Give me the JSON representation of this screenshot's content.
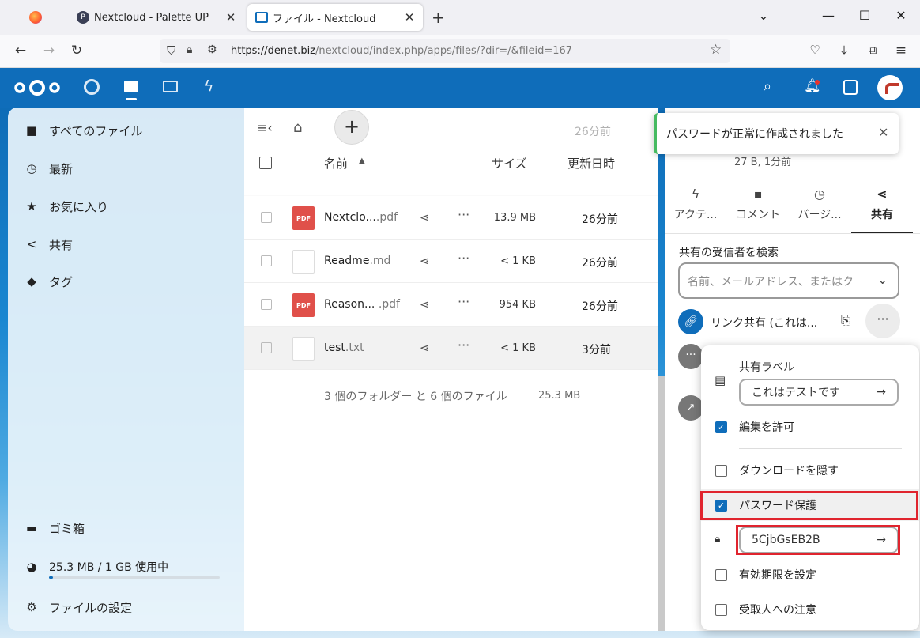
{
  "browser": {
    "tabs": [
      {
        "title": ""
      },
      {
        "title": "Nextcloud - Palette UP"
      },
      {
        "title": "ファイル - Nextcloud"
      }
    ],
    "url_host": "https://denet.biz",
    "url_path": "/nextcloud/index.php/apps/files/?dir=/&fileid=167"
  },
  "sidebar": {
    "items": [
      {
        "label": "すべてのファイル"
      },
      {
        "label": "最新"
      },
      {
        "label": "お気に入り"
      },
      {
        "label": "共有"
      },
      {
        "label": "タグ"
      }
    ],
    "trash": "ゴミ箱",
    "quota": "25.3 MB / 1 GB 使用中",
    "quota_fraction": 0.025,
    "settings": "ファイルの設定"
  },
  "files": {
    "columns": {
      "name": "名前",
      "size": "サイズ",
      "modified": "更新日時"
    },
    "ghost_rows": [
      {
        "date": "26分前"
      },
      {
        "date": "26分前"
      }
    ],
    "rows": [
      {
        "name": "Nextclo...",
        "ext": ".pdf",
        "size": "13.9 MB",
        "date": "26分前",
        "type": "pdf"
      },
      {
        "name": "Readme",
        "ext": ".md",
        "size": "< 1 KB",
        "date": "26分前",
        "type": "md"
      },
      {
        "name": "Reason...",
        "ext": " .pdf",
        "size": "954 KB",
        "date": "26分前",
        "type": "pdf"
      },
      {
        "name": "test",
        "ext": ".txt",
        "size": "< 1 KB",
        "date": "3分前",
        "type": "txt"
      }
    ],
    "summary": "3 個のフォルダー と 6 個のファイル",
    "summary_size": "25.3 MB",
    "pdf_badge": "PDF"
  },
  "toast": {
    "message": "パスワードが正常に作成されました"
  },
  "details": {
    "meta": "27 B, 1分前",
    "tabs": [
      {
        "label": "アクテ..."
      },
      {
        "label": "コメント"
      },
      {
        "label": "バージ..."
      },
      {
        "label": "共有"
      }
    ],
    "search_label": "共有の受信者を検索",
    "search_placeholder": "名前、メールアドレス、またはク",
    "link_share_label": "リンク共有 (これは..."
  },
  "share_menu": {
    "label_title": "共有ラベル",
    "label_value": "これはテストです",
    "allow_edit": "編集を許可",
    "hide_download": "ダウンロードを隠す",
    "password_protect": "パスワード保護",
    "password_value": "5CjbGsEB2B",
    "expiration": "有効期限を設定",
    "note": "受取人への注意"
  },
  "colors": {
    "primary": "#0f6dba",
    "highlight": "#e0242e",
    "success": "#46ba61"
  }
}
